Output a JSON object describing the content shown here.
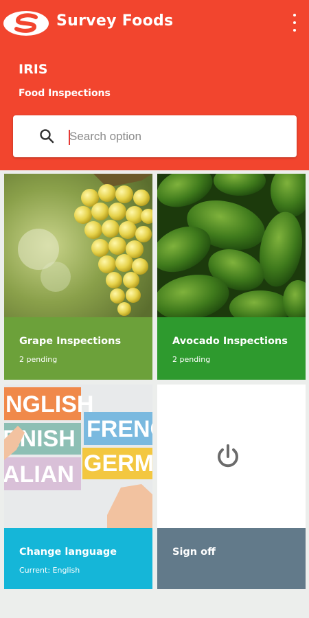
{
  "header": {
    "brand": "Survey Foods",
    "app_title": "IRIS",
    "subtitle": "Food Inspections",
    "menu_icon": "more-vertical-icon",
    "logo_icon": "survey-foods-logo-icon",
    "background": "#f2452e"
  },
  "search": {
    "placeholder": "Search option",
    "value": "",
    "icon": "search-icon"
  },
  "tiles": [
    {
      "title": "Grape Inspections",
      "subtitle": "2 pending",
      "color": "#6ca13a"
    },
    {
      "title": "Avocado Inspections",
      "subtitle": "2 pending",
      "color": "#2e9a2e"
    },
    {
      "title": "Change language",
      "subtitle": "Current: English",
      "color": "#15b6d8"
    },
    {
      "title": "Sign off",
      "subtitle": "",
      "color": "#627a8a",
      "icon": "power-icon"
    }
  ]
}
